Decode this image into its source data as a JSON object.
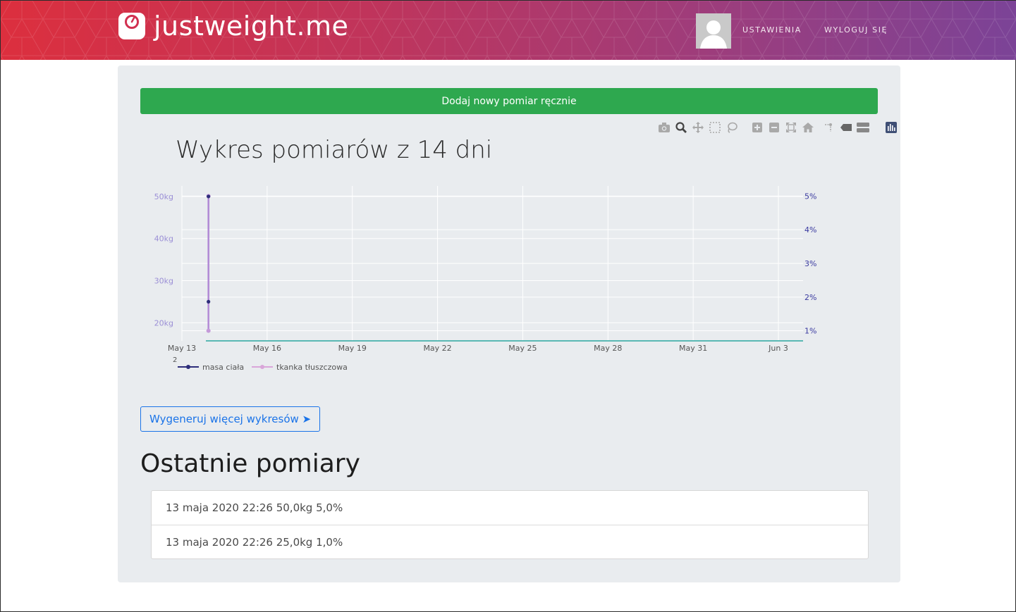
{
  "header": {
    "brand": "justweight.me",
    "nav": [
      "USTAWIENIA",
      "WYLOGUJ SIĘ"
    ]
  },
  "main": {
    "add_button": "Dodaj nowy pomiar ręcznie",
    "more_button": "Wygeneruj więcej wykresów ➤",
    "section_title": "Ostatnie pomiary",
    "measurements": [
      "13 maja 2020 22:26 50,0kg 5,0%",
      "13 maja 2020 22:26 25,0kg 1,0%"
    ]
  },
  "modebar_icons": [
    "camera-icon",
    "zoom-icon",
    "pan-icon",
    "box-select-icon",
    "lasso-icon",
    "zoom-in-icon",
    "zoom-out-icon",
    "autoscale-icon",
    "reset-axes-icon",
    "spike-lines-icon",
    "hover-closest-icon",
    "hover-compare-icon",
    "plotly-logo-icon"
  ],
  "chart_data": {
    "type": "line",
    "title": "Wykres pomiarów z 14 dni",
    "x_ticks": [
      "May 13",
      "May 16",
      "May 19",
      "May 22",
      "May 25",
      "May 28",
      "May 31",
      "Jun 3"
    ],
    "x_tick_sublabel": "2",
    "y_left_ticks": [
      "50kg",
      "40kg",
      "30kg",
      "20kg"
    ],
    "y_right_ticks": [
      "5%",
      "4%",
      "3%",
      "2%",
      "1%"
    ],
    "series": [
      {
        "name": "masa ciała",
        "color": "#2d2d7a",
        "x": [
          "2020-05-13 22:26",
          "2020-05-13 22:26"
        ],
        "values": [
          50,
          25
        ],
        "unit": "kg"
      },
      {
        "name": "tkanka tłuszczowa",
        "color": "#d9a6d9",
        "x": [
          "2020-05-13 22:26",
          "2020-05-13 22:26"
        ],
        "values": [
          5,
          1
        ],
        "unit": "%"
      }
    ],
    "ylim_left": [
      15.7,
      52.5
    ],
    "ylim_right": [
      0.7,
      5.3
    ],
    "grid": true,
    "legend": "bottom-left"
  }
}
